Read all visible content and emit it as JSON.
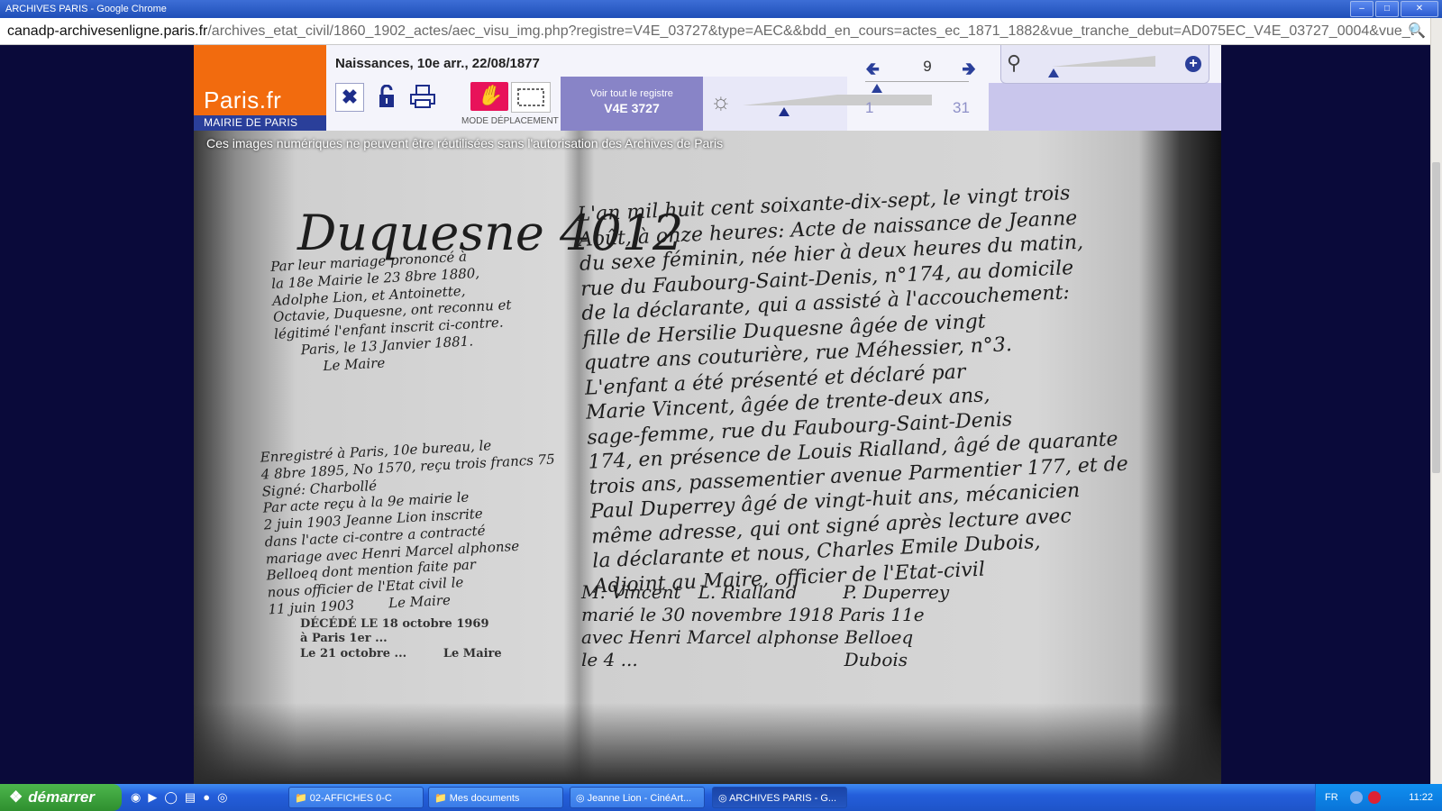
{
  "window": {
    "title": "ARCHIVES PARIS - Google Chrome",
    "btn_min": "–",
    "btn_max": "□",
    "btn_close": "✕"
  },
  "address": {
    "host": "canadp-archivesenligne.paris.fr",
    "path": "/archives_etat_civil/1860_1902_actes/aec_visu_img.php?registre=V4E_03727&type=AEC&&bdd_en_cours=actes_ec_1871_1882&vue_tranche_debut=AD075EC_V4E_03727_0004&vue_t",
    "zoom_icon": "magnifier-icon"
  },
  "viewer": {
    "logo_brand": "Paris.fr",
    "logo_sub": "MAIRIE DE PARIS",
    "record_title": "Naissances, 10e arr., 22/08/1877",
    "mode_label": "MODE DÉPLACEMENT",
    "register_top": "Voir tout le registre",
    "register_code": "V4E 3727",
    "page_current": "9",
    "page_min": "1",
    "page_max": "31",
    "accent_color": "#f26b0e",
    "brand_blue": "#2a3f9a",
    "hand_color": "#e8125a"
  },
  "document": {
    "rights_notice": "Ces images numériques ne peuvent être réutilisées sans l'autorisation des Archives de Paris",
    "margin_name": "Duquesne 4012",
    "margin_note_1": "Par leur mariage prononcé à\nla 18e Mairie le 23 8bre 1880,\nAdolphe Lion, et Antoinette,\nOctavie, Duquesne, ont reconnu et\nlégitimé l'enfant inscrit ci-contre.\n      Paris, le 13 Janvier 1881.\n           Le Maire",
    "margin_note_2": "Enregistré à Paris, 10e bureau, le\n4 8bre 1895, No 1570, reçu trois francs 75\nSigné: Charbollé\nPar acte reçu à la 9e mairie le\n2 juin 1903 Jeanne Lion inscrite\ndans l'acte ci-contre a contracté\nmariage avec Henri Marcel alphonse\nBelloeq dont mention faite par\nnous officier de l'Etat civil le\n11 juin 1903        Le Maire",
    "deceased_note": "DÉCÉDÉ LE 18 octobre 1969\nà Paris 1er ...\nLe 21 octobre ...         Le Maire",
    "main_text": "L'an mil huit cent soixante-dix-sept, le vingt trois\nAoût, à onze heures: Acte de naissance de Jeanne\ndu sexe féminin, née hier à deux heures du matin,\nrue du Faubourg-Saint-Denis, n°174, au domicile\nde la déclarante, qui a assisté à l'accouchement:\nfille de Hersilie Duquesne âgée de vingt\nquatre ans couturière, rue Méhessier, n°3.\nL'enfant a été présenté et déclaré par\nMarie Vincent, âgée de trente-deux ans,\nsage-femme, rue du Faubourg-Saint-Denis\n174, en présence de Louis Rialland, âgé de quarante\ntrois ans, passementier avenue Parmentier 177, et de\nPaul Duperrey âgé de vingt-huit ans, mécanicien\nmême adresse, qui ont signé après lecture avec\nla déclarante et nous, Charles Emile Dubois,\nAdjoint au Maire, officier de l'Etat-civil",
    "signatures": "M. Vincent   L. Rialland        P. Duperrey\nmarié le 30 novembre 1918 Paris 11e\navec Henri Marcel alphonse Belloeq\nle 4 ...                                    Dubois"
  },
  "taskbar": {
    "start_label": "démarrer",
    "tasks": [
      {
        "label": "02-AFFICHES 0-C"
      },
      {
        "label": "Mes documents"
      },
      {
        "label": "Jeanne Lion - CinéArt..."
      },
      {
        "label": "ARCHIVES PARIS - G..."
      }
    ],
    "lang": "FR",
    "clock": "11:22"
  }
}
